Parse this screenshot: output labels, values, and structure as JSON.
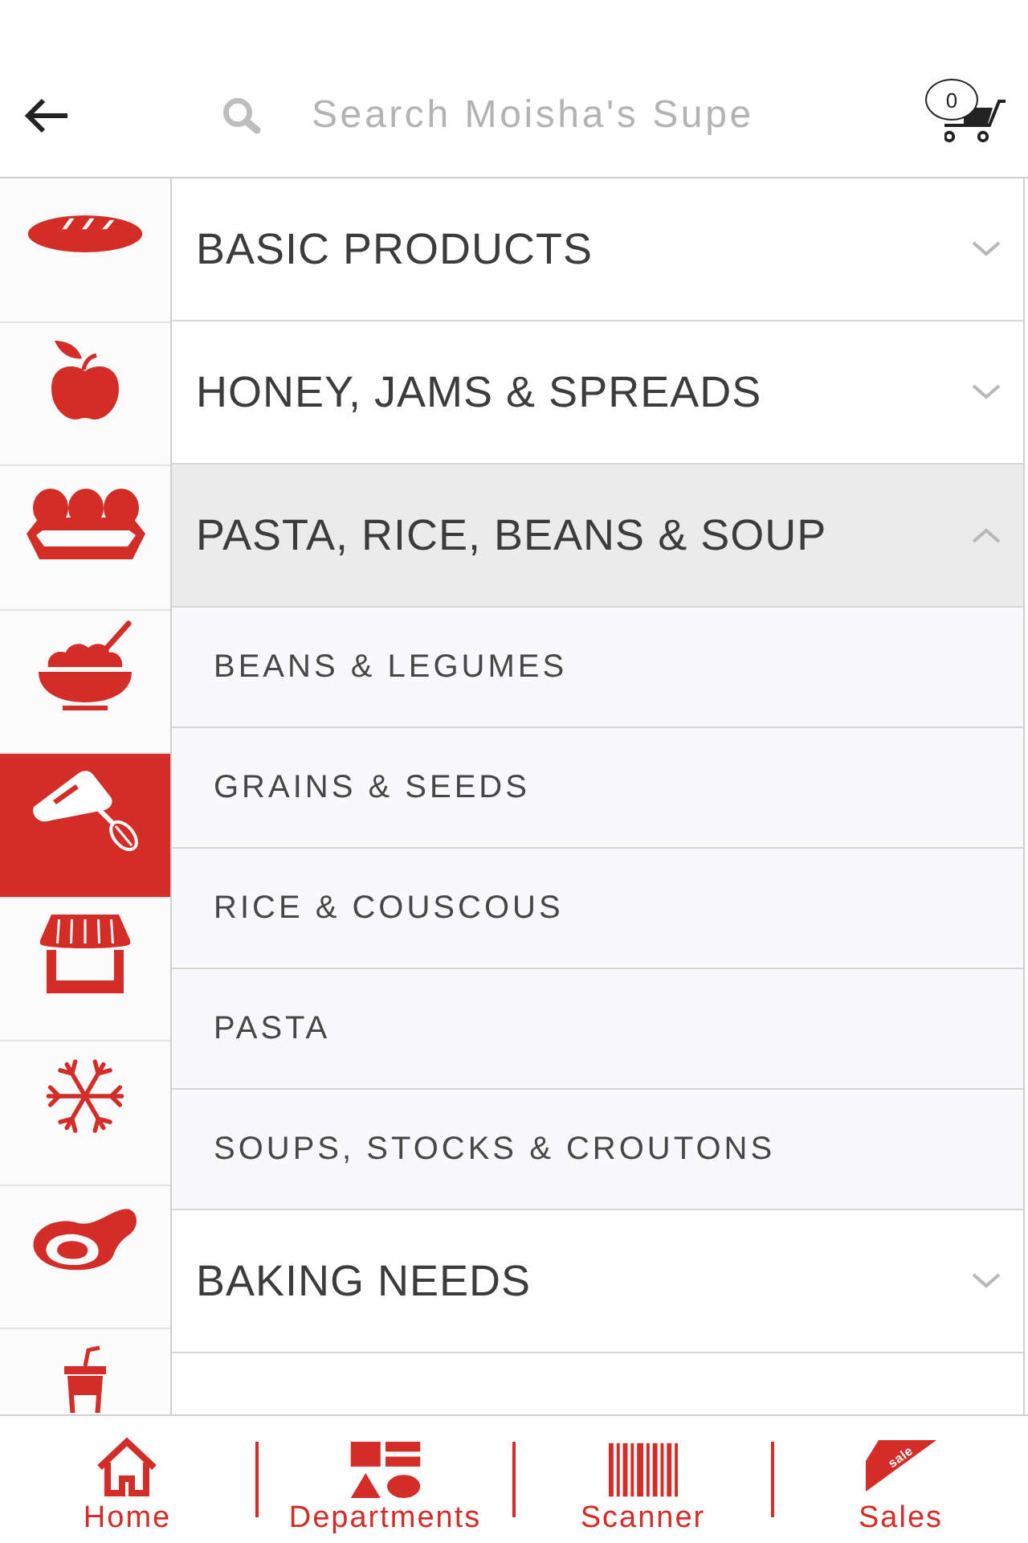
{
  "search": {
    "placeholder": "Search Moisha's Supe"
  },
  "cart": {
    "count": "0"
  },
  "sidebar": {
    "items": [
      {
        "selected": false
      },
      {
        "selected": false
      },
      {
        "selected": false
      },
      {
        "selected": false
      },
      {
        "selected": true
      },
      {
        "selected": false
      },
      {
        "selected": false
      },
      {
        "selected": false
      },
      {
        "selected": false
      }
    ]
  },
  "categories": [
    {
      "label": "BASIC PRODUCTS",
      "expanded": false
    },
    {
      "label": "HONEY, JAMS & SPREADS",
      "expanded": false
    },
    {
      "label": "PASTA, RICE, BEANS & SOUP",
      "expanded": true,
      "children": [
        {
          "label": "BEANS & LEGUMES"
        },
        {
          "label": "GRAINS & SEEDS"
        },
        {
          "label": "RICE & COUSCOUS"
        },
        {
          "label": "PASTA"
        },
        {
          "label": "SOUPS, STOCKS & CROUTONS"
        }
      ]
    },
    {
      "label": "BAKING NEEDS",
      "expanded": false
    }
  ],
  "bottom_nav": {
    "items": [
      {
        "label": "Home"
      },
      {
        "label": "Departments"
      },
      {
        "label": "Scanner"
      },
      {
        "label": "Sales",
        "icon_text": "sale"
      }
    ]
  }
}
